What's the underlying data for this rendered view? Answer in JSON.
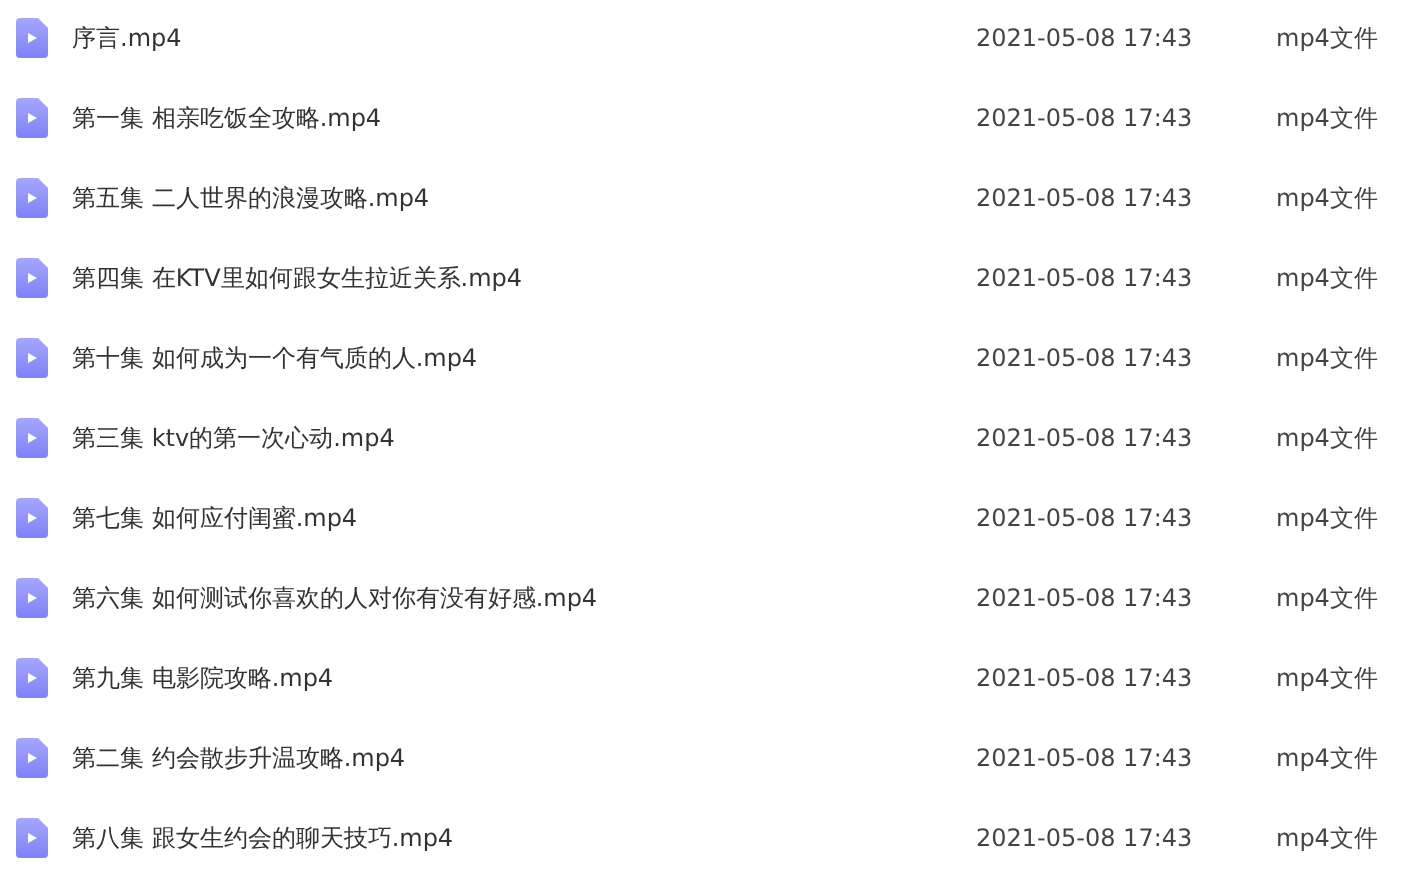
{
  "files": [
    {
      "name": "序言.mp4",
      "modified": "2021-05-08 17:43",
      "type": "mp4文件"
    },
    {
      "name": "第一集 相亲吃饭全攻略.mp4",
      "modified": "2021-05-08 17:43",
      "type": "mp4文件"
    },
    {
      "name": "第五集 二人世界的浪漫攻略.mp4",
      "modified": "2021-05-08 17:43",
      "type": "mp4文件"
    },
    {
      "name": "第四集 在KTV里如何跟女生拉近关系.mp4",
      "modified": "2021-05-08 17:43",
      "type": "mp4文件"
    },
    {
      "name": "第十集 如何成为一个有气质的人.mp4",
      "modified": "2021-05-08 17:43",
      "type": "mp4文件"
    },
    {
      "name": "第三集 ktv的第一次心动.mp4",
      "modified": "2021-05-08 17:43",
      "type": "mp4文件"
    },
    {
      "name": "第七集 如何应付闺蜜.mp4",
      "modified": "2021-05-08 17:43",
      "type": "mp4文件"
    },
    {
      "name": "第六集 如何测试你喜欢的人对你有没有好感.mp4",
      "modified": "2021-05-08 17:43",
      "type": "mp4文件"
    },
    {
      "name": "第九集 电影院攻略.mp4",
      "modified": "2021-05-08 17:43",
      "type": "mp4文件"
    },
    {
      "name": "第二集 约会散步升温攻略.mp4",
      "modified": "2021-05-08 17:43",
      "type": "mp4文件"
    },
    {
      "name": "第八集 跟女生约会的聊天技巧.mp4",
      "modified": "2021-05-08 17:43",
      "type": "mp4文件"
    }
  ]
}
